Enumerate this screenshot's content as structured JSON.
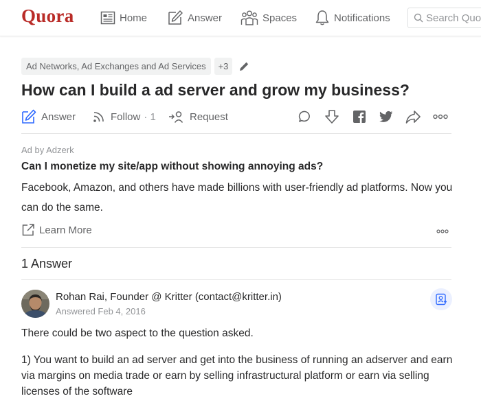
{
  "header": {
    "logo": "Quora",
    "nav": {
      "home": "Home",
      "answer": "Answer",
      "spaces": "Spaces",
      "notifications": "Notifications"
    },
    "search_placeholder": "Search Quora"
  },
  "question": {
    "topics": [
      "Ad Networks, Ad Exchanges and Ad Services"
    ],
    "more_topics": "+3",
    "title": "How can I build a ad server and grow my business?",
    "actions": {
      "answer": "Answer",
      "follow": "Follow",
      "follow_count": "· 1",
      "request": "Request"
    }
  },
  "ad": {
    "by": "Ad by Adzerk",
    "title": "Can I monetize my site/app without showing annoying ads?",
    "body": "Facebook, Amazon, and others have made billions with user-friendly ad platforms. Now you can do the same.",
    "cta": "Learn More"
  },
  "answers": {
    "count_label": "1 Answer",
    "items": [
      {
        "author": "Rohan Rai, Founder @ Kritter (contact@kritter.in)",
        "date": "Answered Feb 4, 2016",
        "paragraphs": [
          "There could be two aspect to the question asked.",
          "1) You want to build an ad server and get into the business of running an adserver and earn via margins on media trade or earn by selling infrastructural platform or earn via selling licenses of the software"
        ]
      }
    ]
  },
  "colors": {
    "brand": "#b92b27",
    "accent_blue": "#2e69ff",
    "text": "#282829",
    "muted": "#636466"
  }
}
